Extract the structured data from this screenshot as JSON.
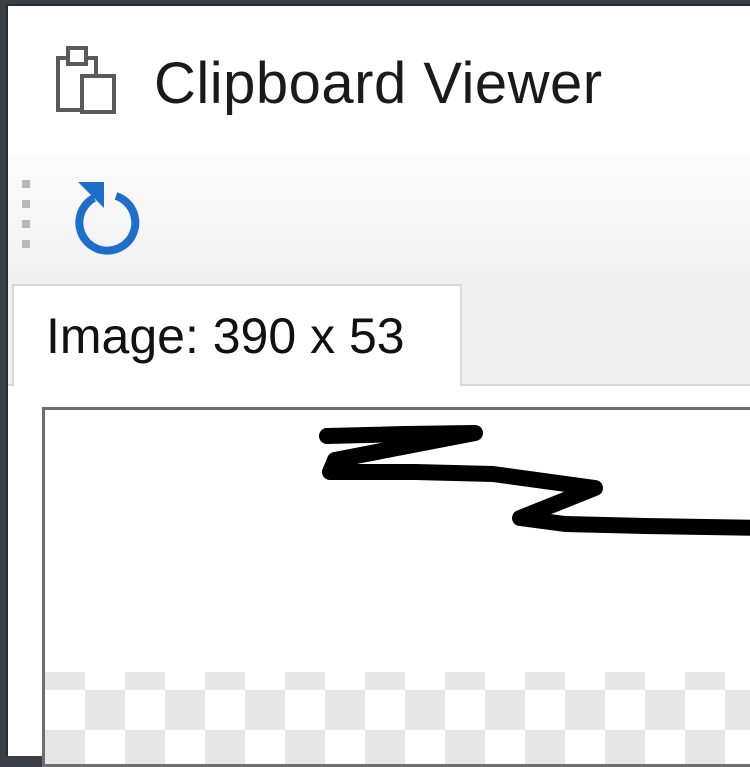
{
  "window": {
    "title": "Clipboard Viewer",
    "app_icon": "clipboard-icon"
  },
  "toolbar": {
    "refresh_icon": "refresh-icon",
    "accent_color": "#1e6fc9"
  },
  "tabs": [
    {
      "label": "Image: 390 x 53",
      "active": true
    }
  ],
  "preview": {
    "content": "black ink scribble on white with transparency checkerboard below"
  }
}
